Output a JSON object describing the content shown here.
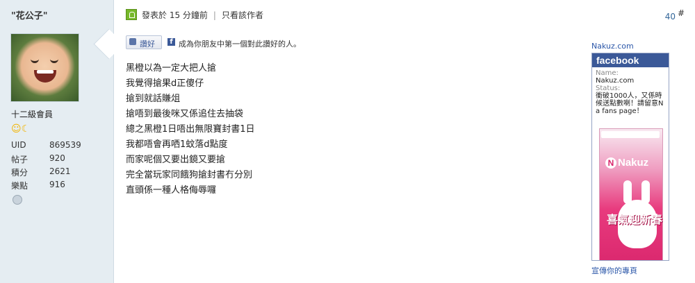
{
  "author": {
    "name": "\"花公子\"",
    "rank": "十二級會員",
    "stats": [
      {
        "label": "UID",
        "value": "869539"
      },
      {
        "label": "帖子",
        "value": "920"
      },
      {
        "label": "積分",
        "value": "2621"
      },
      {
        "label": "樂點",
        "value": "916"
      }
    ]
  },
  "post": {
    "posted_time": "發表於 15 分鐘前",
    "only_author": "只看該作者",
    "floor": "40",
    "floor_hash": "#",
    "like_label": "讚好",
    "like_prompt": "成為你朋友中第一個對此讚好的人。",
    "lines": [
      "黑橙以為一定大把人搶",
      "我覺得搶果d正傻仔",
      "搶到就話賺俎",
      "搶唔到最後咪又係追住去抽袋",
      "總之黑橙1日唔出無限寶封書1日",
      "我都唔會再哂1蚊落d點度",
      "而家呢個又要出鏡又要搶",
      "完全當玩家同餓狗搶封書冇分別",
      "直頭係一種人格侮辱囉"
    ]
  },
  "widget": {
    "site": "Nakuz.com",
    "brand": "facebook",
    "name_label": "Name:",
    "name_value": "Nakuz.com",
    "status_label": "Status:",
    "status_value": "衝破1000人，又係時候送點數喇！請留意Na fans page！",
    "banner_logo": "Nakuz",
    "banner_text": "喜氣迎新春",
    "link": "宣傳你的專頁"
  }
}
